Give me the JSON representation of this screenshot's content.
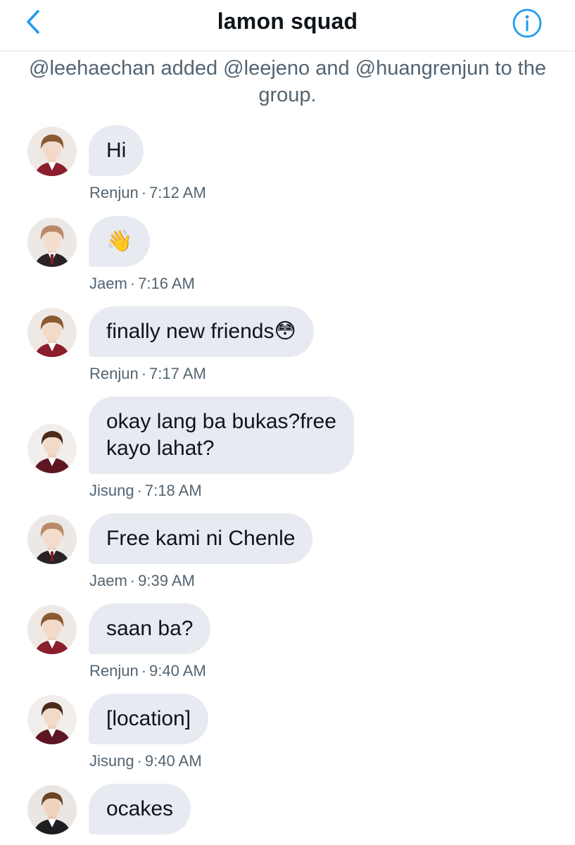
{
  "header": {
    "title": "lamon squad",
    "back_icon": "chevron-left-icon",
    "info_icon": "info-icon"
  },
  "system_message": "@leehaechan added @leejeno and @huangrenjun to the group.",
  "colors": {
    "accent": "#1d9bf0",
    "bubble": "#e7eaf0",
    "meta_text": "#536471",
    "text": "#0f1419"
  },
  "messages": [
    {
      "sender": "Renjun",
      "time": "7:12 AM",
      "text": "Hi",
      "avatar": "renjun"
    },
    {
      "sender": "Jaem",
      "time": "7:16 AM",
      "text": "👋",
      "avatar": "jaem"
    },
    {
      "sender": "Renjun",
      "time": "7:17 AM",
      "text": "finally new friends😳",
      "avatar": "renjun"
    },
    {
      "sender": "Jisung",
      "time": "7:18 AM",
      "text": "okay lang ba bukas?free\nkayo lahat?",
      "avatar": "jisung"
    },
    {
      "sender": "Jaem",
      "time": "9:39 AM",
      "text": "Free kami ni Chenle",
      "avatar": "jaem"
    },
    {
      "sender": "Renjun",
      "time": "9:40 AM",
      "text": "saan ba?",
      "avatar": "renjun"
    },
    {
      "sender": "Jisung",
      "time": "9:40 AM",
      "text": "[location]",
      "avatar": "jisung"
    },
    {
      "sender": "",
      "time": "",
      "text": "ocakes",
      "avatar": "unknown"
    }
  ],
  "meta_separator": "·"
}
